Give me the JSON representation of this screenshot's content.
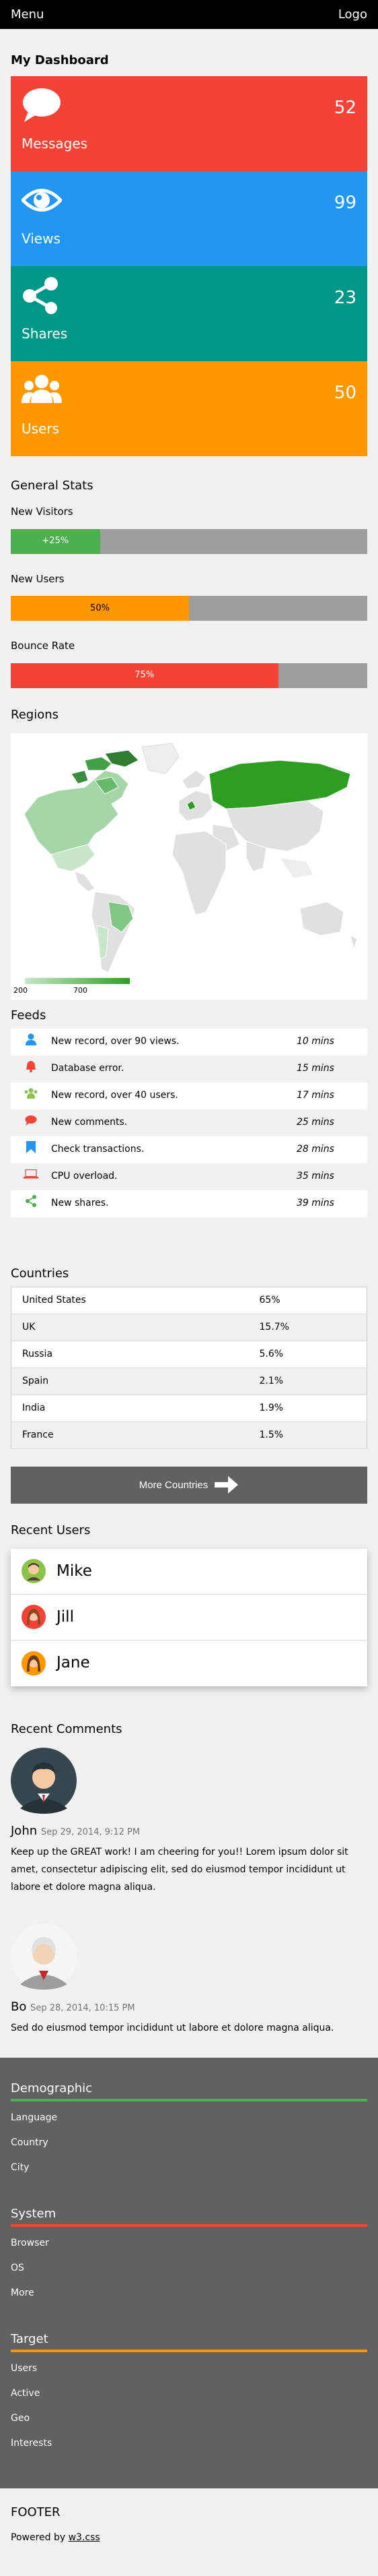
{
  "topbar": {
    "menu": "Menu",
    "logo": "Logo"
  },
  "dashboard": {
    "title": "My Dashboard",
    "cards": [
      {
        "label": "Messages",
        "value": "52",
        "icon": "comment-icon",
        "color": "#f44336"
      },
      {
        "label": "Views",
        "value": "99",
        "icon": "eye-icon",
        "color": "#2196f3"
      },
      {
        "label": "Shares",
        "value": "23",
        "icon": "share-icon",
        "color": "#009688"
      },
      {
        "label": "Users",
        "value": "50",
        "icon": "users-icon",
        "color": "#ff9800"
      }
    ]
  },
  "general_stats": {
    "title": "General Stats",
    "items": [
      {
        "label": "New Visitors",
        "value_text": "+25%",
        "fraction": 0.25,
        "color": "#4caf50"
      },
      {
        "label": "New Users",
        "value_text": "50%",
        "fraction": 0.5,
        "color": "#ff9800"
      },
      {
        "label": "Bounce Rate",
        "value_text": "75%",
        "fraction": 0.75,
        "color": "#f44336"
      }
    ]
  },
  "regions": {
    "title": "Regions",
    "legend_min": "200",
    "legend_max": "700"
  },
  "feeds": {
    "title": "Feeds",
    "rows": [
      {
        "icon": "user-icon",
        "icon_color": "#2196f3",
        "text": "New record, over 90 views.",
        "time": "10 mins"
      },
      {
        "icon": "bell-icon",
        "icon_color": "#f44336",
        "text": "Database error.",
        "time": "15 mins"
      },
      {
        "icon": "users-icon",
        "icon_color": "#8bc34a",
        "text": "New record, over 40 users.",
        "time": "17 mins"
      },
      {
        "icon": "comment-icon",
        "icon_color": "#f44336",
        "text": "New comments.",
        "time": "25 mins"
      },
      {
        "icon": "bookmark-icon",
        "icon_color": "#2196f3",
        "text": "Check transactions.",
        "time": "28 mins"
      },
      {
        "icon": "laptop-icon",
        "icon_color": "#f44336",
        "text": "CPU overload.",
        "time": "35 mins"
      },
      {
        "icon": "share-icon",
        "icon_color": "#4caf50",
        "text": "New shares.",
        "time": "39 mins"
      }
    ]
  },
  "countries": {
    "title": "Countries",
    "rows": [
      {
        "name": "United States",
        "pct": "65%"
      },
      {
        "name": "UK",
        "pct": "15.7%"
      },
      {
        "name": "Russia",
        "pct": "5.6%"
      },
      {
        "name": "Spain",
        "pct": "2.1%"
      },
      {
        "name": "India",
        "pct": "1.9%"
      },
      {
        "name": "France",
        "pct": "1.5%"
      }
    ],
    "more_button": "More Countries"
  },
  "recent_users": {
    "title": "Recent Users",
    "users": [
      {
        "name": "Mike",
        "avatar_color": "#8bc34a"
      },
      {
        "name": "Jill",
        "avatar_color": "#f44336"
      },
      {
        "name": "Jane",
        "avatar_color": "#ff9800"
      }
    ]
  },
  "recent_comments": {
    "title": "Recent Comments",
    "comments": [
      {
        "name": "John",
        "date": "Sep 29, 2014, 9:12 PM",
        "text": "Keep up the GREAT work! I am cheering for you!! Lorem ipsum dolor sit amet, consectetur adipiscing elit, sed do eiusmod tempor incididunt ut labore et dolore magna aliqua."
      },
      {
        "name": "Bo",
        "date": "Sep 28, 2014, 10:15 PM",
        "text": "Sed do eiusmod tempor incididunt ut labore et dolore magna aliqua."
      }
    ]
  },
  "sidebar_footer": {
    "groups": [
      {
        "title": "Demographic",
        "color": "#4caf50",
        "items": [
          "Language",
          "Country",
          "City"
        ]
      },
      {
        "title": "System",
        "color": "#f44336",
        "items": [
          "Browser",
          "OS",
          "More"
        ]
      },
      {
        "title": "Target",
        "color": "#ff9800",
        "items": [
          "Users",
          "Active",
          "Geo",
          "Interests"
        ]
      }
    ]
  },
  "footer": {
    "title": "FOOTER",
    "powered_prefix": "Powered by ",
    "powered_link": "w3.css"
  }
}
